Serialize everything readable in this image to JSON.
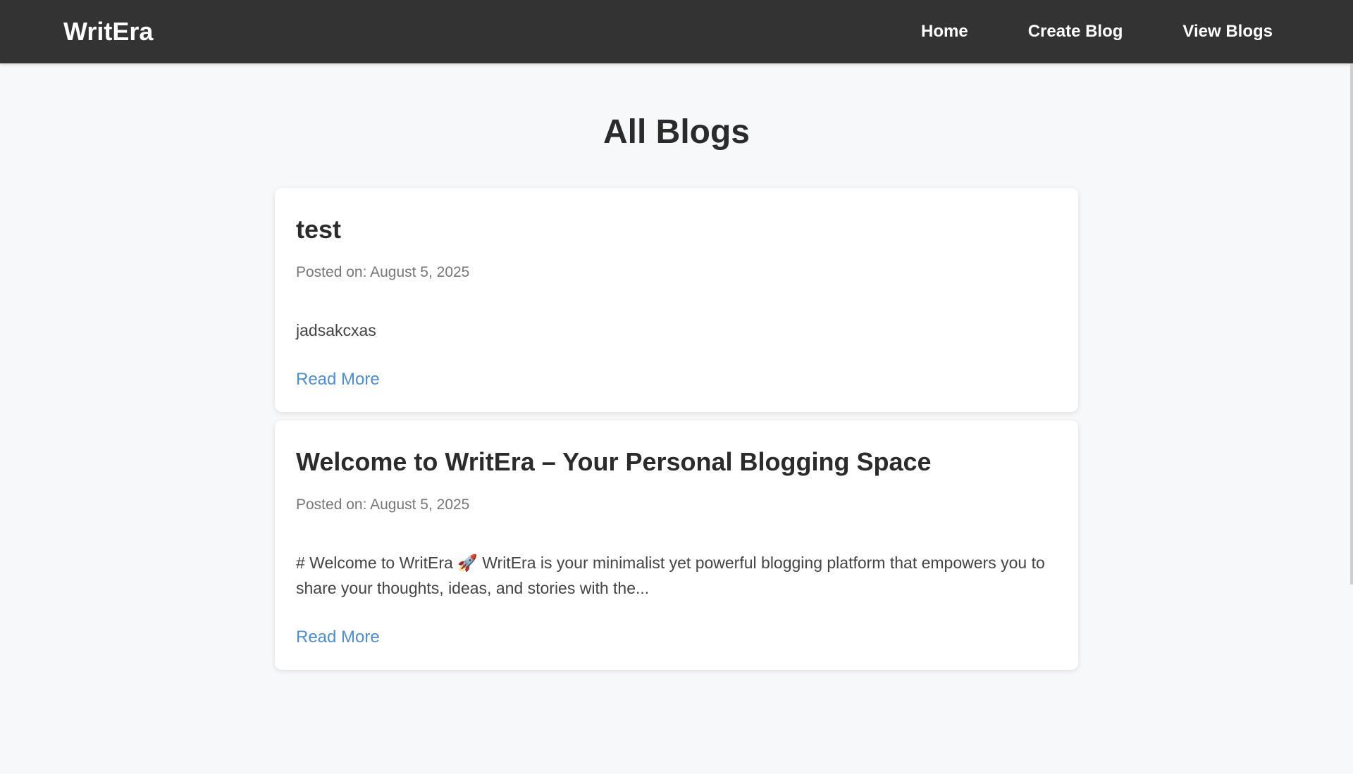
{
  "nav": {
    "brand": "WritEra",
    "links": [
      "Home",
      "Create Blog",
      "View Blogs"
    ]
  },
  "main": {
    "title": "All Blogs",
    "blogs": [
      {
        "title": "test",
        "date": "Posted on: August 5, 2025",
        "excerpt": "jadsakcxas",
        "read_more": "Read More"
      },
      {
        "title": "Welcome to WritEra – Your Personal Blogging Space",
        "date": "Posted on: August 5, 2025",
        "excerpt": "# Welcome to WritEra 🚀 WritEra is your minimalist yet powerful blogging platform that empowers you to share your thoughts, ideas, and stories with the...",
        "read_more": "Read More"
      }
    ]
  },
  "colors": {
    "navbar_bg": "#333333",
    "page_bg": "#f7f8fa",
    "link_blue": "#4a8fd8"
  }
}
